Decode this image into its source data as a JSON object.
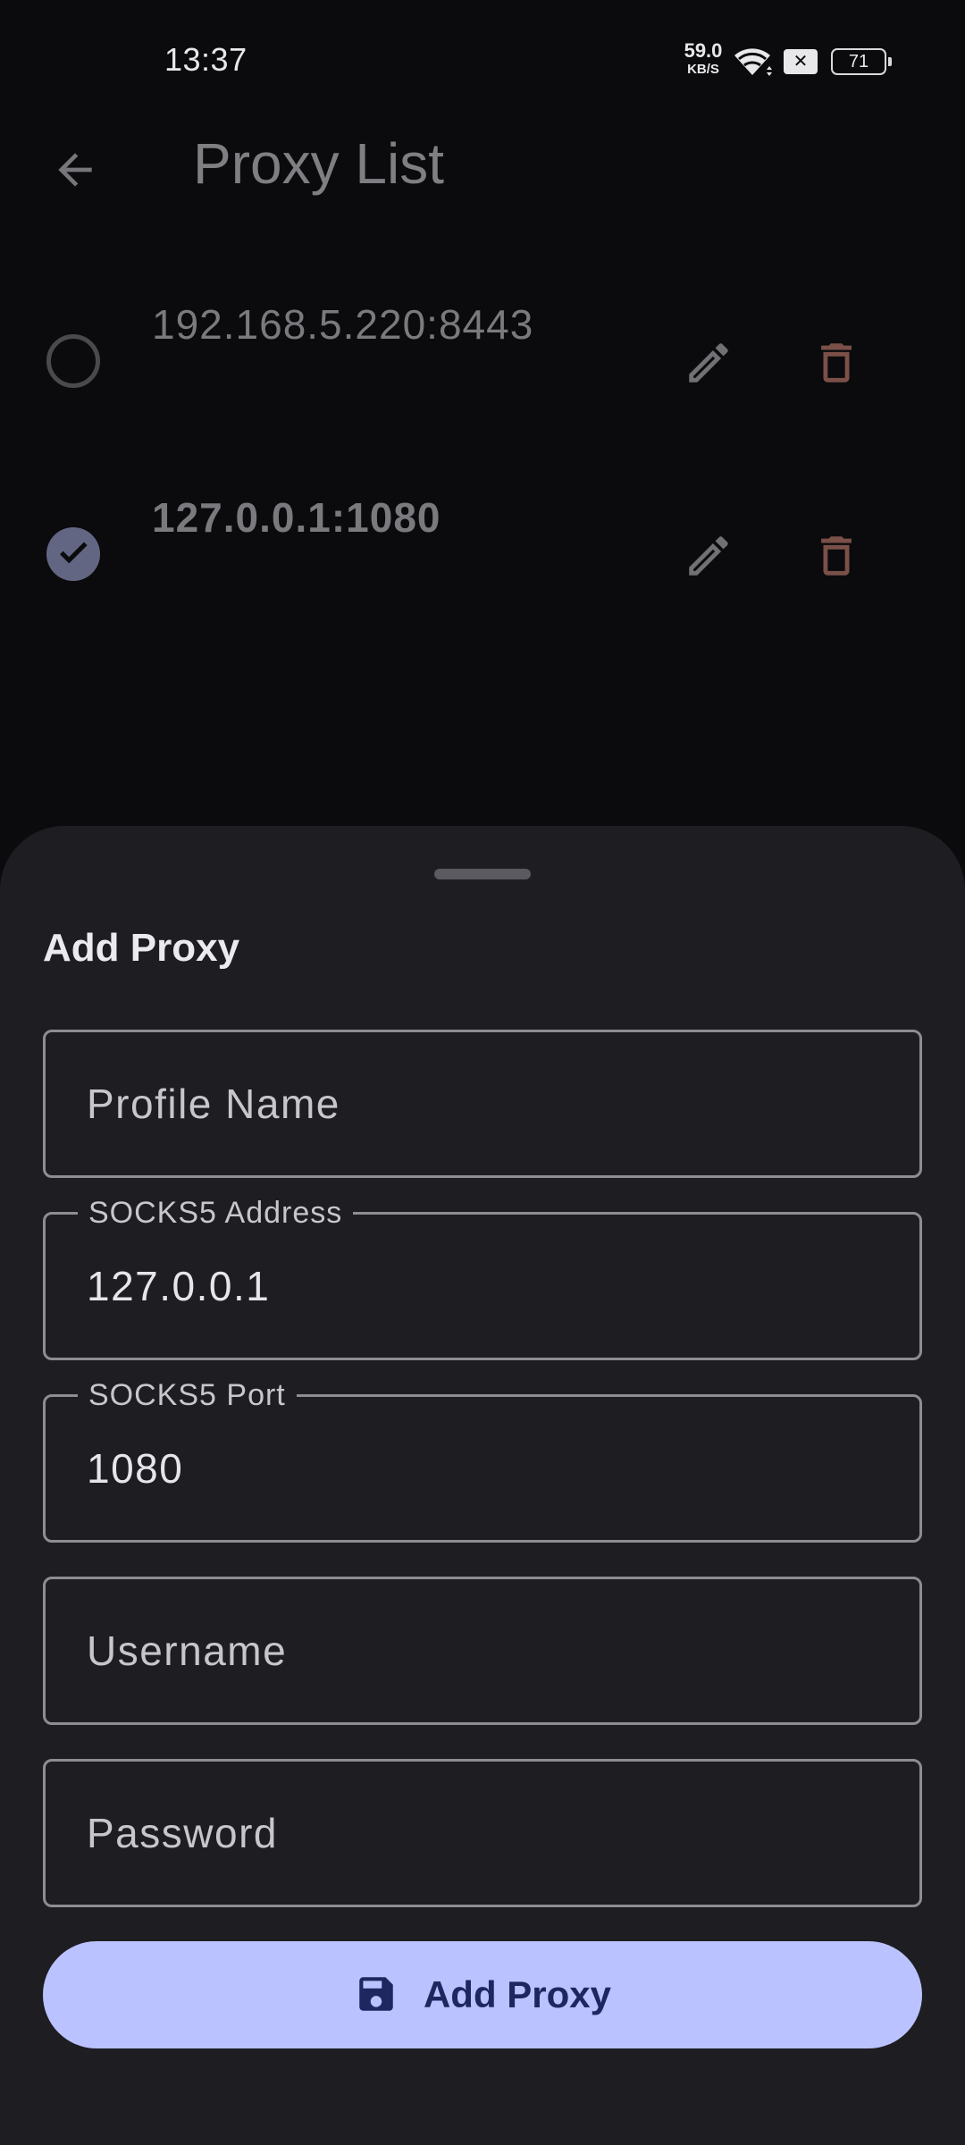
{
  "status_bar": {
    "time": "13:37",
    "net_speed_value": "59.0",
    "net_speed_unit": "KB/S",
    "battery_level": "71",
    "icons": [
      "wifi-icon",
      "sim-disabled-icon",
      "battery-icon"
    ]
  },
  "app_bar": {
    "title": "Proxy List",
    "back_icon": "arrow-back-icon"
  },
  "proxies": [
    {
      "label": "192.168.5.220:8443",
      "selected": false
    },
    {
      "label": "127.0.0.1:1080",
      "selected": true
    }
  ],
  "sheet": {
    "title": "Add Proxy",
    "fields": {
      "profile_name": {
        "placeholder": "Profile Name",
        "value": ""
      },
      "socks5_address": {
        "label": "SOCKS5 Address",
        "value": "127.0.0.1"
      },
      "socks5_port": {
        "label": "SOCKS5 Port",
        "value": "1080"
      },
      "username": {
        "placeholder": "Username",
        "value": ""
      },
      "password": {
        "placeholder": "Password",
        "value": ""
      }
    },
    "submit_label": "Add Proxy",
    "submit_icon": "save-icon"
  },
  "colors": {
    "background": "#0b0b0d",
    "sheet": "#1d1d22",
    "accent": "#bac3ff",
    "accent_text": "#1f2760",
    "delete_icon": "#7a5048",
    "selected_radio": "#636683"
  }
}
